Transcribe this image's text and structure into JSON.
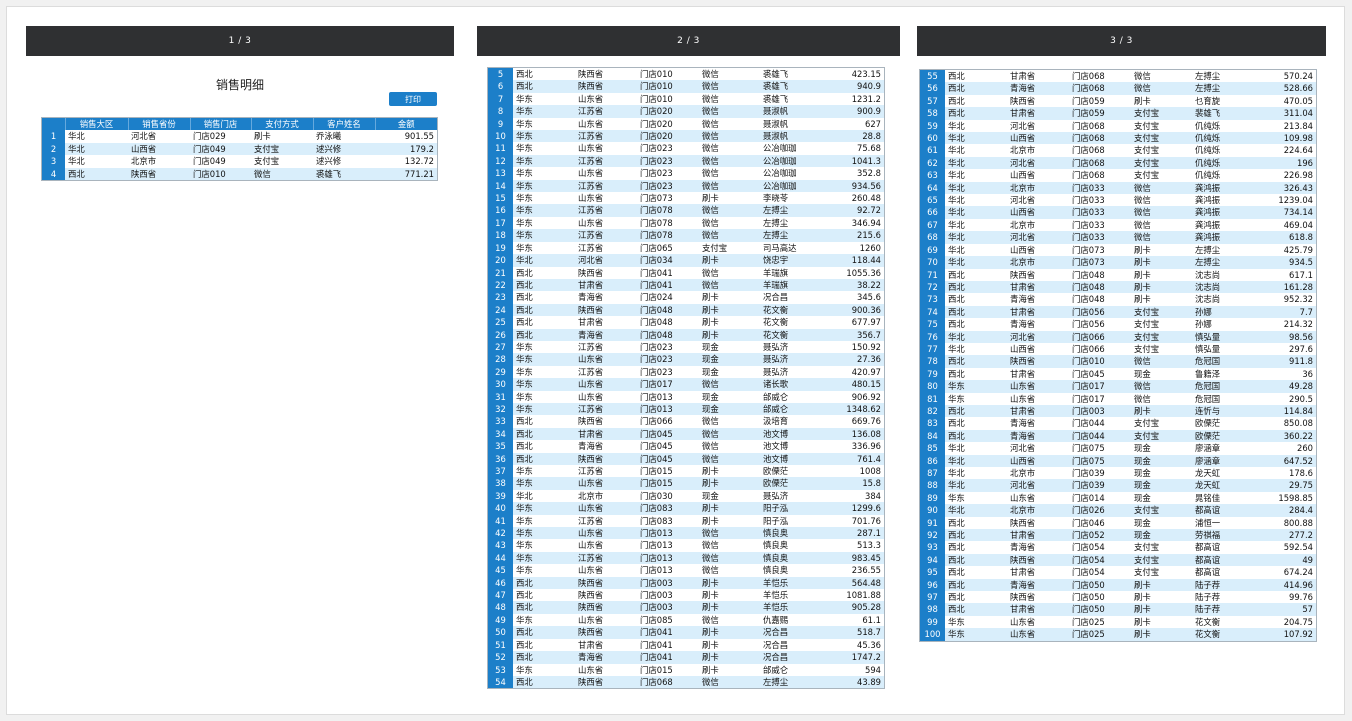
{
  "pages": [
    {
      "label": "1 / 3"
    },
    {
      "label": "2 / 3"
    },
    {
      "label": "3 / 3"
    }
  ],
  "report": {
    "title": "销售明细",
    "print_label": "打印",
    "columns": [
      "",
      "销售大区",
      "销售省份",
      "销售门店",
      "支付方式",
      "客户姓名",
      "金额"
    ]
  },
  "page1_rows": [
    [
      "1",
      "华北",
      "河北省",
      "门店029",
      "刷卡",
      "乔泳曦",
      "901.55"
    ],
    [
      "2",
      "华北",
      "山西省",
      "门店049",
      "支付宝",
      "逑兴修",
      "179.2"
    ],
    [
      "3",
      "华北",
      "北京市",
      "门店049",
      "支付宝",
      "逑兴修",
      "132.72"
    ],
    [
      "4",
      "西北",
      "陕西省",
      "门店010",
      "微信",
      "裘雄飞",
      "771.21"
    ]
  ],
  "page2_rows": [
    [
      "5",
      "西北",
      "陕西省",
      "门店010",
      "微信",
      "裘雄飞",
      "423.15"
    ],
    [
      "6",
      "西北",
      "陕西省",
      "门店010",
      "微信",
      "裘雄飞",
      "940.9"
    ],
    [
      "7",
      "华东",
      "山东省",
      "门店010",
      "微信",
      "裘雄飞",
      "1231.2"
    ],
    [
      "8",
      "华东",
      "江苏省",
      "门店020",
      "微信",
      "聂淑帆",
      "900.9"
    ],
    [
      "9",
      "华东",
      "山东省",
      "门店020",
      "微信",
      "聂淑帆",
      "627"
    ],
    [
      "10",
      "华东",
      "江苏省",
      "门店020",
      "微信",
      "聂淑帆",
      "28.8"
    ],
    [
      "11",
      "华东",
      "山东省",
      "门店023",
      "微信",
      "公冶咖珈",
      "75.68"
    ],
    [
      "12",
      "华东",
      "江苏省",
      "门店023",
      "微信",
      "公冶咖珈",
      "1041.3"
    ],
    [
      "13",
      "华东",
      "山东省",
      "门店023",
      "微信",
      "公冶咖珈",
      "352.8"
    ],
    [
      "14",
      "华东",
      "江苏省",
      "门店023",
      "微信",
      "公冶咖珈",
      "934.56"
    ],
    [
      "15",
      "华东",
      "山东省",
      "门店073",
      "刷卡",
      "李晓苓",
      "260.48"
    ],
    [
      "16",
      "华东",
      "江苏省",
      "门店078",
      "微信",
      "左搏尘",
      "92.72"
    ],
    [
      "17",
      "华东",
      "山东省",
      "门店078",
      "微信",
      "左搏尘",
      "346.94"
    ],
    [
      "18",
      "华东",
      "江苏省",
      "门店078",
      "微信",
      "左搏尘",
      "215.6"
    ],
    [
      "19",
      "华东",
      "江苏省",
      "门店065",
      "支付宝",
      "司马高达",
      "1260"
    ],
    [
      "20",
      "华北",
      "河北省",
      "门店034",
      "刷卡",
      "饶忠宇",
      "118.44"
    ],
    [
      "21",
      "西北",
      "陕西省",
      "门店041",
      "微信",
      "羊瑞旗",
      "1055.36"
    ],
    [
      "22",
      "西北",
      "甘肃省",
      "门店041",
      "微信",
      "羊瑞旗",
      "38.22"
    ],
    [
      "23",
      "西北",
      "青海省",
      "门店024",
      "刷卡",
      "况合昌",
      "345.6"
    ],
    [
      "24",
      "西北",
      "陕西省",
      "门店048",
      "刷卡",
      "花文衡",
      "900.36"
    ],
    [
      "25",
      "西北",
      "甘肃省",
      "门店048",
      "刷卡",
      "花文衡",
      "677.97"
    ],
    [
      "26",
      "西北",
      "青海省",
      "门店048",
      "刷卡",
      "花文衡",
      "356.7"
    ],
    [
      "27",
      "华东",
      "江苏省",
      "门店023",
      "现金",
      "聂弘济",
      "150.92"
    ],
    [
      "28",
      "华东",
      "山东省",
      "门店023",
      "现金",
      "聂弘济",
      "27.36"
    ],
    [
      "29",
      "华东",
      "江苏省",
      "门店023",
      "现金",
      "聂弘济",
      "420.97"
    ],
    [
      "30",
      "华东",
      "山东省",
      "门店017",
      "微信",
      "诸长歌",
      "480.15"
    ],
    [
      "31",
      "华东",
      "山东省",
      "门店013",
      "现金",
      "邰威仑",
      "906.92"
    ],
    [
      "32",
      "华东",
      "江苏省",
      "门店013",
      "现金",
      "邰威仑",
      "1348.62"
    ],
    [
      "33",
      "西北",
      "陕西省",
      "门店066",
      "微信",
      "汲培育",
      "669.76"
    ],
    [
      "34",
      "西北",
      "甘肃省",
      "门店045",
      "微信",
      "池文博",
      "136.08"
    ],
    [
      "35",
      "西北",
      "青海省",
      "门店045",
      "微信",
      "池文博",
      "336.96"
    ],
    [
      "36",
      "西北",
      "陕西省",
      "门店045",
      "微信",
      "池文博",
      "761.4"
    ],
    [
      "37",
      "华东",
      "江苏省",
      "门店015",
      "刷卡",
      "欧傈茫",
      "1008"
    ],
    [
      "38",
      "华东",
      "山东省",
      "门店015",
      "刷卡",
      "欧傈茫",
      "15.8"
    ],
    [
      "39",
      "华北",
      "北京市",
      "门店030",
      "现金",
      "聂弘济",
      "384"
    ],
    [
      "40",
      "华东",
      "山东省",
      "门店083",
      "刷卡",
      "阳子泓",
      "1299.6"
    ],
    [
      "41",
      "华东",
      "江苏省",
      "门店083",
      "刷卡",
      "阳子泓",
      "701.76"
    ],
    [
      "42",
      "华东",
      "山东省",
      "门店013",
      "微信",
      "慎良奥",
      "287.1"
    ],
    [
      "43",
      "华东",
      "山东省",
      "门店013",
      "微信",
      "慎良奥",
      "513.3"
    ],
    [
      "44",
      "华东",
      "江苏省",
      "门店013",
      "微信",
      "慎良奥",
      "983.45"
    ],
    [
      "45",
      "华东",
      "山东省",
      "门店013",
      "微信",
      "慎良奥",
      "236.55"
    ],
    [
      "46",
      "西北",
      "陕西省",
      "门店003",
      "刷卡",
      "羊恺乐",
      "564.48"
    ],
    [
      "47",
      "西北",
      "陕西省",
      "门店003",
      "刷卡",
      "羊恺乐",
      "1081.88"
    ],
    [
      "48",
      "西北",
      "陕西省",
      "门店003",
      "刷卡",
      "羊恺乐",
      "905.28"
    ],
    [
      "49",
      "华东",
      "山东省",
      "门店085",
      "微信",
      "仇嘉赐",
      "61.1"
    ],
    [
      "50",
      "西北",
      "陕西省",
      "门店041",
      "刷卡",
      "况合昌",
      "518.7"
    ],
    [
      "51",
      "西北",
      "甘肃省",
      "门店041",
      "刷卡",
      "况合昌",
      "45.36"
    ],
    [
      "52",
      "西北",
      "青海省",
      "门店041",
      "刷卡",
      "况合昌",
      "1747.2"
    ],
    [
      "53",
      "华东",
      "山东省",
      "门店015",
      "刷卡",
      "邰威仑",
      "594"
    ],
    [
      "54",
      "西北",
      "陕西省",
      "门店068",
      "微信",
      "左搏尘",
      "43.89"
    ]
  ],
  "page3_rows": [
    [
      "55",
      "西北",
      "甘肃省",
      "门店068",
      "微信",
      "左搏尘",
      "570.24"
    ],
    [
      "56",
      "西北",
      "青海省",
      "门店068",
      "微信",
      "左搏尘",
      "528.66"
    ],
    [
      "57",
      "西北",
      "陕西省",
      "门店059",
      "刷卡",
      "乜育旋",
      "470.05"
    ],
    [
      "58",
      "西北",
      "甘肃省",
      "门店059",
      "支付宝",
      "裴雄飞",
      "311.04"
    ],
    [
      "59",
      "华北",
      "河北省",
      "门店068",
      "支付宝",
      "仉纯烁",
      "213.84"
    ],
    [
      "60",
      "华北",
      "山西省",
      "门店068",
      "支付宝",
      "仉纯烁",
      "109.98"
    ],
    [
      "61",
      "华北",
      "北京市",
      "门店068",
      "支付宝",
      "仉纯烁",
      "224.64"
    ],
    [
      "62",
      "华北",
      "河北省",
      "门店068",
      "支付宝",
      "仉纯烁",
      "196"
    ],
    [
      "63",
      "华北",
      "山西省",
      "门店068",
      "支付宝",
      "仉纯烁",
      "226.98"
    ],
    [
      "64",
      "华北",
      "北京市",
      "门店033",
      "微信",
      "龚鸿振",
      "326.43"
    ],
    [
      "65",
      "华北",
      "河北省",
      "门店033",
      "微信",
      "龚鸿振",
      "1239.04"
    ],
    [
      "66",
      "华北",
      "山西省",
      "门店033",
      "微信",
      "龚鸿振",
      "734.14"
    ],
    [
      "67",
      "华北",
      "北京市",
      "门店033",
      "微信",
      "龚鸿振",
      "469.04"
    ],
    [
      "68",
      "华北",
      "河北省",
      "门店033",
      "微信",
      "龚鸿振",
      "618.8"
    ],
    [
      "69",
      "华北",
      "山西省",
      "门店073",
      "刷卡",
      "左搏尘",
      "425.79"
    ],
    [
      "70",
      "华北",
      "北京市",
      "门店073",
      "刷卡",
      "左搏尘",
      "934.5"
    ],
    [
      "71",
      "西北",
      "陕西省",
      "门店048",
      "刷卡",
      "沈志尚",
      "617.1"
    ],
    [
      "72",
      "西北",
      "甘肃省",
      "门店048",
      "刷卡",
      "沈志尚",
      "161.28"
    ],
    [
      "73",
      "西北",
      "青海省",
      "门店048",
      "刷卡",
      "沈志尚",
      "952.32"
    ],
    [
      "74",
      "西北",
      "甘肃省",
      "门店056",
      "支付宝",
      "孙娜",
      "7.7"
    ],
    [
      "75",
      "西北",
      "青海省",
      "门店056",
      "支付宝",
      "孙娜",
      "214.32"
    ],
    [
      "76",
      "华北",
      "河北省",
      "门店066",
      "支付宝",
      "慎弘量",
      "98.56"
    ],
    [
      "77",
      "华北",
      "山西省",
      "门店066",
      "支付宝",
      "慎弘量",
      "297.6"
    ],
    [
      "78",
      "西北",
      "陕西省",
      "门店010",
      "微信",
      "危冠国",
      "911.8"
    ],
    [
      "79",
      "西北",
      "甘肃省",
      "门店045",
      "现金",
      "鲁籍泽",
      "36"
    ],
    [
      "80",
      "华东",
      "山东省",
      "门店017",
      "微信",
      "危冠国",
      "49.28"
    ],
    [
      "81",
      "华东",
      "山东省",
      "门店017",
      "微信",
      "危冠国",
      "290.5"
    ],
    [
      "82",
      "西北",
      "甘肃省",
      "门店003",
      "刷卡",
      "连忻与",
      "114.84"
    ],
    [
      "83",
      "西北",
      "青海省",
      "门店044",
      "支付宝",
      "欧傈茫",
      "850.08"
    ],
    [
      "84",
      "西北",
      "青海省",
      "门店044",
      "支付宝",
      "欧傈茫",
      "360.22"
    ],
    [
      "85",
      "华北",
      "河北省",
      "门店075",
      "现金",
      "廖涵章",
      "260"
    ],
    [
      "86",
      "华北",
      "山西省",
      "门店075",
      "现金",
      "廖涵章",
      "647.52"
    ],
    [
      "87",
      "华北",
      "北京市",
      "门店039",
      "现金",
      "龙天虹",
      "178.6"
    ],
    [
      "88",
      "华北",
      "河北省",
      "门店039",
      "现金",
      "龙天虹",
      "29.75"
    ],
    [
      "89",
      "华东",
      "山东省",
      "门店014",
      "现金",
      "晁铭佳",
      "1598.85"
    ],
    [
      "90",
      "华北",
      "北京市",
      "门店026",
      "支付宝",
      "都高谊",
      "284.4"
    ],
    [
      "91",
      "西北",
      "陕西省",
      "门店046",
      "现金",
      "浦恒一",
      "800.88"
    ],
    [
      "92",
      "西北",
      "甘肃省",
      "门店052",
      "现金",
      "劳祺福",
      "277.2"
    ],
    [
      "93",
      "西北",
      "青海省",
      "门店054",
      "支付宝",
      "都高谊",
      "592.54"
    ],
    [
      "94",
      "西北",
      "陕西省",
      "门店054",
      "支付宝",
      "都高谊",
      "49"
    ],
    [
      "95",
      "西北",
      "甘肃省",
      "门店054",
      "支付宝",
      "都高谊",
      "674.24"
    ],
    [
      "96",
      "西北",
      "青海省",
      "门店050",
      "刷卡",
      "陆子荐",
      "414.96"
    ],
    [
      "97",
      "西北",
      "陕西省",
      "门店050",
      "刷卡",
      "陆子荐",
      "99.76"
    ],
    [
      "98",
      "西北",
      "甘肃省",
      "门店050",
      "刷卡",
      "陆子荐",
      "57"
    ],
    [
      "99",
      "华东",
      "山东省",
      "门店025",
      "刷卡",
      "花文衡",
      "204.75"
    ],
    [
      "100",
      "华东",
      "山东省",
      "门店025",
      "刷卡",
      "花文衡",
      "107.92"
    ]
  ]
}
